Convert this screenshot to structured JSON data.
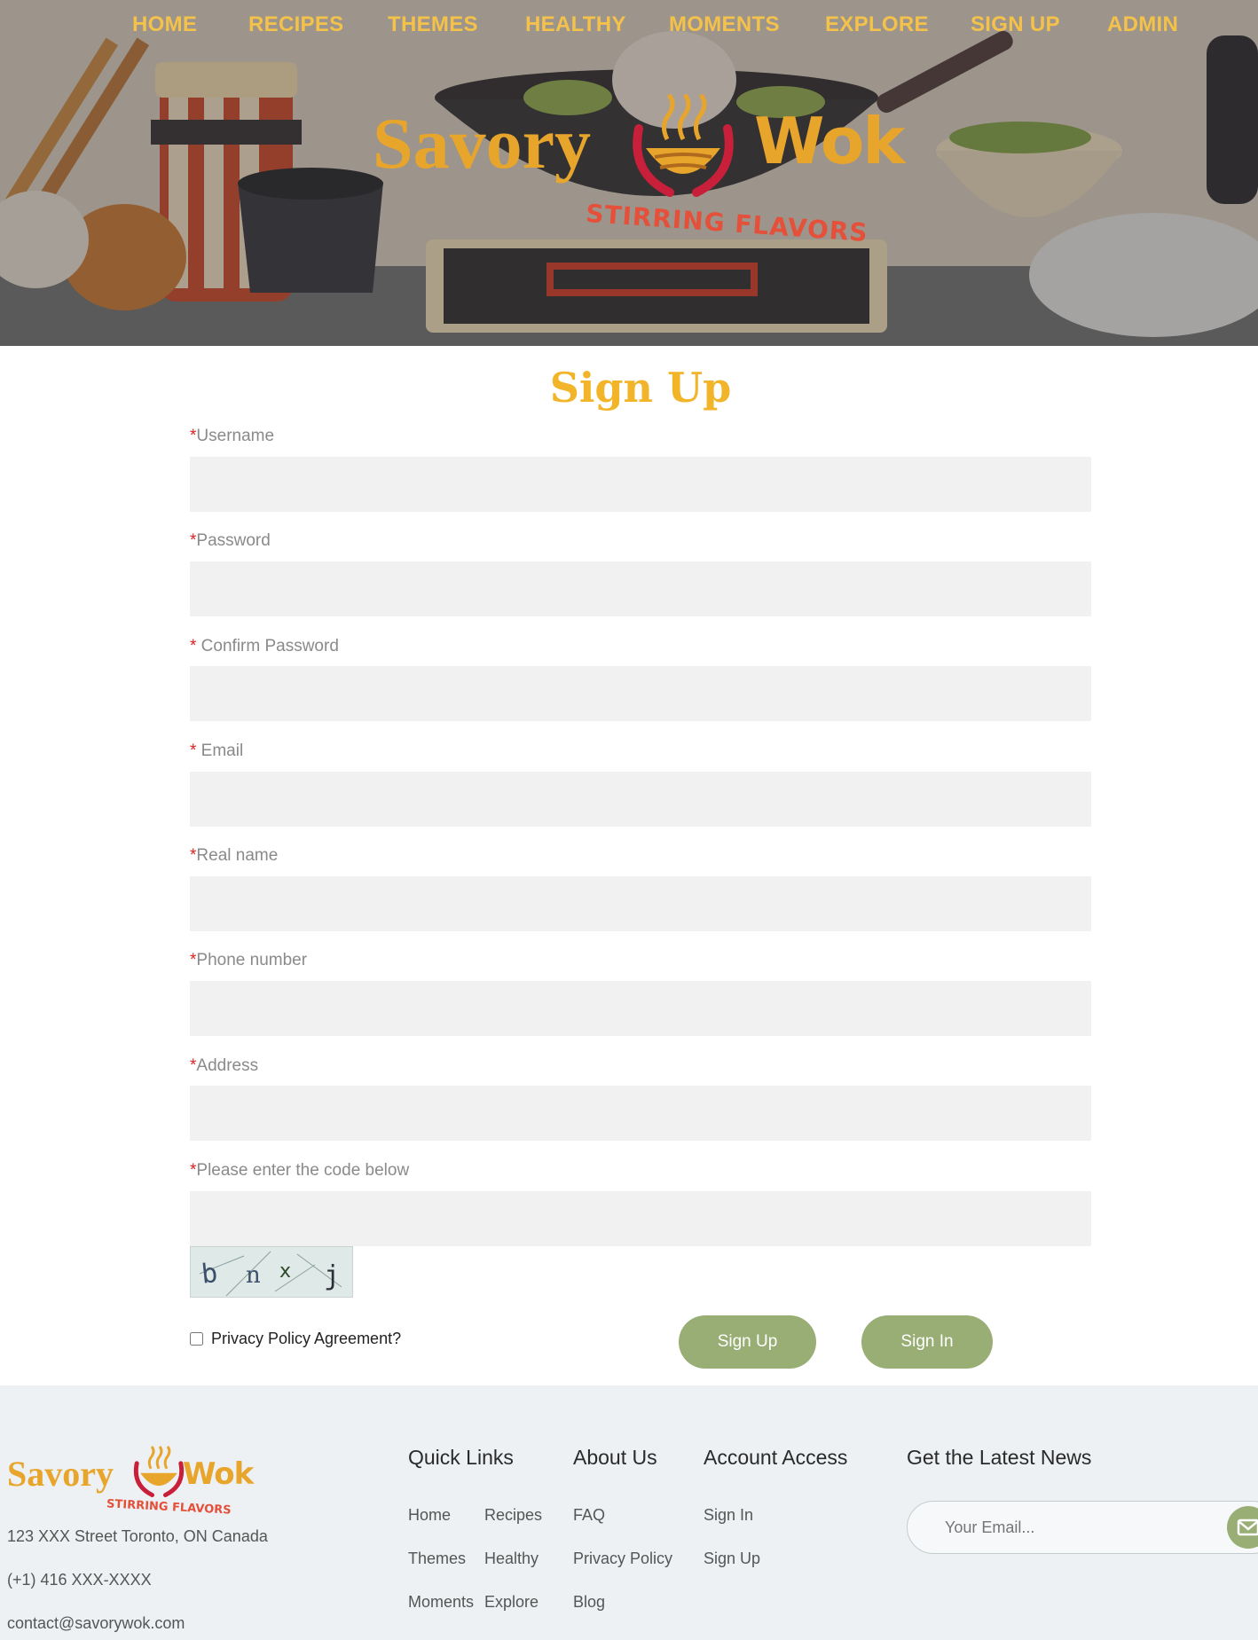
{
  "nav": {
    "items": [
      {
        "label": "HOME"
      },
      {
        "label": "RECIPES"
      },
      {
        "label": "THEMES"
      },
      {
        "label": "HEALTHY"
      },
      {
        "label": "MOMENTS"
      },
      {
        "label": "EXPLORE"
      },
      {
        "label": "SIGN UP"
      },
      {
        "label": "ADMIN"
      }
    ]
  },
  "brand": {
    "name_left": "Savory",
    "name_right": "Wok",
    "tagline": "STIRRING FLAVORS",
    "colors": {
      "gold": "#e8a52c",
      "red": "#e4503a",
      "nav": "#f4c24a"
    }
  },
  "form": {
    "title": "Sign Up",
    "required_marker": "*",
    "fields": [
      {
        "label": "Username",
        "value": ""
      },
      {
        "label": "Password",
        "value": ""
      },
      {
        "label": " Confirm Password",
        "value": ""
      },
      {
        "label": " Email",
        "value": ""
      },
      {
        "label": "Real name",
        "value": ""
      },
      {
        "label": "Phone number",
        "value": ""
      },
      {
        "label": "Address",
        "value": ""
      },
      {
        "label": "Please enter the code below",
        "value": ""
      }
    ],
    "privacy_label": "Privacy Policy Agreement?",
    "privacy_checked": false,
    "signup_button": "Sign Up",
    "signin_button": "Sign In",
    "button_color": "#98ae74"
  },
  "footer": {
    "address": "123 XXX Street Toronto, ON Canada",
    "phone": "(+1) 416 XXX-XXXX",
    "email": "contact@savorywok.com",
    "quick_links": {
      "title": "Quick Links",
      "items": [
        "Home",
        "Recipes",
        "Themes",
        "Healthy",
        "Moments",
        "Explore"
      ]
    },
    "about": {
      "title": "About Us",
      "items": [
        "FAQ",
        "Privacy Policy",
        "Blog"
      ]
    },
    "account": {
      "title": "Account Access",
      "items": [
        "Sign In",
        "Sign Up"
      ]
    },
    "news": {
      "title": "Get the Latest News",
      "placeholder": "Your Email..."
    }
  }
}
